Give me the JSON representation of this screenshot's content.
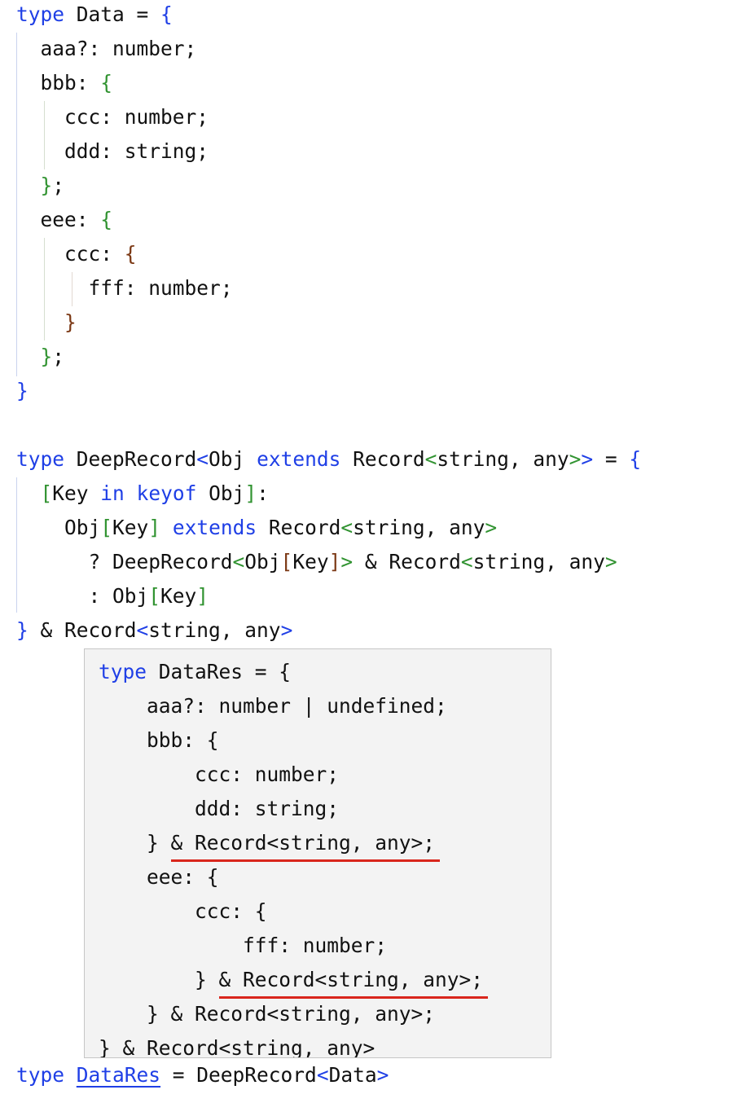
{
  "editor": {
    "lines": [
      {
        "row": 0,
        "tokens": [
          {
            "t": "type",
            "c": "k"
          },
          {
            "t": " Data = "
          },
          {
            "t": "{",
            "c": "b1"
          }
        ]
      },
      {
        "row": 1,
        "tokens": [
          {
            "t": "  aaa?: number;"
          }
        ]
      },
      {
        "row": 2,
        "tokens": [
          {
            "t": "  bbb: "
          },
          {
            "t": "{",
            "c": "b2"
          }
        ]
      },
      {
        "row": 3,
        "tokens": [
          {
            "t": "    ccc: number;"
          }
        ]
      },
      {
        "row": 4,
        "tokens": [
          {
            "t": "    ddd: string;"
          }
        ]
      },
      {
        "row": 5,
        "tokens": [
          {
            "t": "  "
          },
          {
            "t": "}",
            "c": "b2"
          },
          {
            "t": ";"
          }
        ]
      },
      {
        "row": 6,
        "tokens": [
          {
            "t": "  eee: "
          },
          {
            "t": "{",
            "c": "b2"
          }
        ]
      },
      {
        "row": 7,
        "tokens": [
          {
            "t": "    ccc: "
          },
          {
            "t": "{",
            "c": "b3"
          }
        ]
      },
      {
        "row": 8,
        "tokens": [
          {
            "t": "      fff: number;"
          }
        ]
      },
      {
        "row": 9,
        "tokens": [
          {
            "t": "    "
          },
          {
            "t": "}",
            "c": "b3"
          }
        ]
      },
      {
        "row": 10,
        "tokens": [
          {
            "t": "  "
          },
          {
            "t": "}",
            "c": "b2"
          },
          {
            "t": ";"
          }
        ]
      },
      {
        "row": 11,
        "tokens": [
          {
            "t": "}",
            "c": "b1"
          }
        ]
      },
      {
        "row": 13,
        "tokens": [
          {
            "t": "type",
            "c": "k"
          },
          {
            "t": " DeepRecord"
          },
          {
            "t": "<",
            "c": "b1"
          },
          {
            "t": "Obj "
          },
          {
            "t": "extends",
            "c": "k"
          },
          {
            "t": " Record"
          },
          {
            "t": "<",
            "c": "b2"
          },
          {
            "t": "string, any"
          },
          {
            "t": ">",
            "c": "b2"
          },
          {
            "t": ">",
            "c": "b1"
          },
          {
            "t": " = "
          },
          {
            "t": "{",
            "c": "b1"
          }
        ]
      },
      {
        "row": 14,
        "tokens": [
          {
            "t": "  "
          },
          {
            "t": "[",
            "c": "b2"
          },
          {
            "t": "Key "
          },
          {
            "t": "in",
            "c": "k"
          },
          {
            "t": " "
          },
          {
            "t": "keyof",
            "c": "k"
          },
          {
            "t": " Obj"
          },
          {
            "t": "]",
            "c": "b2"
          },
          {
            "t": ":"
          }
        ]
      },
      {
        "row": 15,
        "tokens": [
          {
            "t": "    Obj"
          },
          {
            "t": "[",
            "c": "b2"
          },
          {
            "t": "Key"
          },
          {
            "t": "]",
            "c": "b2"
          },
          {
            "t": " "
          },
          {
            "t": "extends",
            "c": "k"
          },
          {
            "t": " Record"
          },
          {
            "t": "<",
            "c": "b2"
          },
          {
            "t": "string, any"
          },
          {
            "t": ">",
            "c": "b2"
          }
        ]
      },
      {
        "row": 16,
        "tokens": [
          {
            "t": "      ? DeepRecord"
          },
          {
            "t": "<",
            "c": "b2"
          },
          {
            "t": "Obj"
          },
          {
            "t": "[",
            "c": "b3"
          },
          {
            "t": "Key"
          },
          {
            "t": "]",
            "c": "b3"
          },
          {
            "t": ">",
            "c": "b2"
          },
          {
            "t": " & Record"
          },
          {
            "t": "<",
            "c": "b2"
          },
          {
            "t": "string, any"
          },
          {
            "t": ">",
            "c": "b2"
          }
        ]
      },
      {
        "row": 17,
        "tokens": [
          {
            "t": "      : Obj"
          },
          {
            "t": "[",
            "c": "b2"
          },
          {
            "t": "Key"
          },
          {
            "t": "]",
            "c": "b2"
          }
        ]
      },
      {
        "row": 18,
        "tokens": [
          {
            "t": "}",
            "c": "b1"
          },
          {
            "t": " & Record"
          },
          {
            "t": "<",
            "c": "b1"
          },
          {
            "t": "string, any"
          },
          {
            "t": ">",
            "c": "b1"
          }
        ]
      },
      {
        "row": 31,
        "tokens": [
          {
            "t": "type",
            "c": "k"
          },
          {
            "t": " "
          },
          {
            "t": "DataRes",
            "c": "link"
          },
          {
            "t": " = DeepRecord"
          },
          {
            "t": "<",
            "c": "b1"
          },
          {
            "t": "Data"
          },
          {
            "t": ">",
            "c": "b1"
          }
        ]
      }
    ]
  },
  "hover_tooltip": {
    "lines": [
      {
        "tokens": [
          {
            "t": "type",
            "c": "k"
          },
          {
            "t": " DataRes = {"
          }
        ]
      },
      {
        "tokens": [
          {
            "t": "    aaa?: number | undefined;"
          }
        ]
      },
      {
        "tokens": [
          {
            "t": "    bbb: {"
          }
        ]
      },
      {
        "tokens": [
          {
            "t": "        ccc: number;"
          }
        ]
      },
      {
        "tokens": [
          {
            "t": "        ddd: string;"
          }
        ]
      },
      {
        "tokens": [
          {
            "t": "    } "
          },
          {
            "t": "& Record<string, any>;",
            "c": "ul"
          }
        ]
      },
      {
        "tokens": [
          {
            "t": "    eee: {"
          }
        ]
      },
      {
        "tokens": [
          {
            "t": "        ccc: {"
          }
        ]
      },
      {
        "tokens": [
          {
            "t": "            fff: number;"
          }
        ]
      },
      {
        "tokens": [
          {
            "t": "        } "
          },
          {
            "t": "& Record<string, any>;",
            "c": "ul"
          }
        ]
      },
      {
        "tokens": [
          {
            "t": "    } & Record<string, any>;"
          }
        ]
      },
      {
        "tokens": [
          {
            "t": "} & Record<string, any>"
          }
        ]
      }
    ]
  }
}
